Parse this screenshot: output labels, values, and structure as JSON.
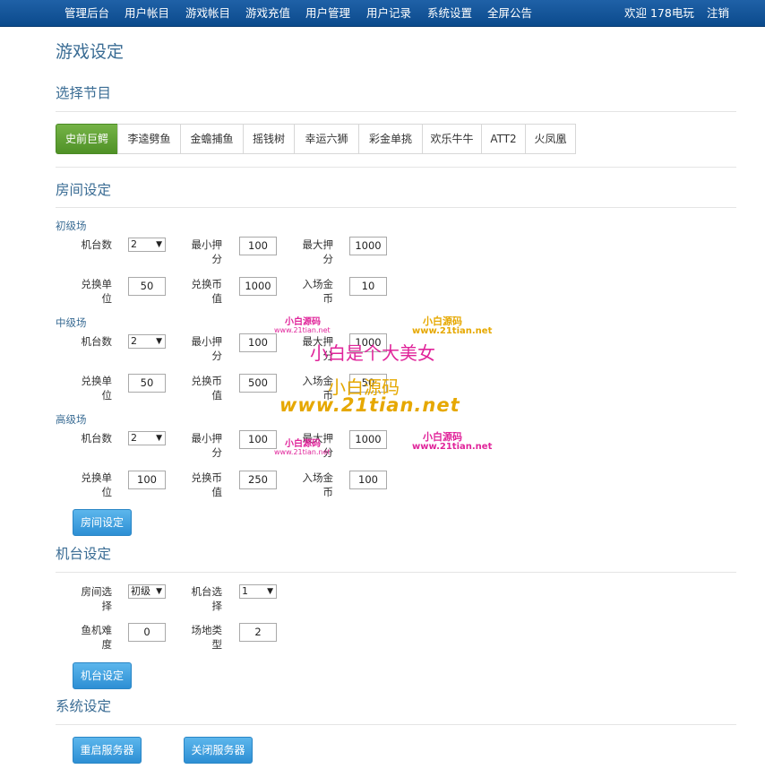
{
  "nav": {
    "items": [
      "管理后台",
      "用户帐目",
      "游戏帐目",
      "游戏充值",
      "用户管理",
      "用户记录",
      "系统设置",
      "全屏公告"
    ],
    "welcome": "欢迎 178电玩",
    "logout": "注销"
  },
  "page_title": "游戏设定",
  "select_program": {
    "title": "选择节目",
    "tabs": [
      "史前巨鳄",
      "李逵劈鱼",
      "金蟾捕鱼",
      "摇钱树",
      "幸运六狮",
      "彩金单挑",
      "欢乐牛牛",
      "ATT2",
      "火凤凰"
    ],
    "active_index": 0
  },
  "room": {
    "title": "房间设定",
    "levels": [
      {
        "name": "初级场",
        "machines": "2",
        "min_bet": "100",
        "max_bet": "1000",
        "exchange_unit": "50",
        "exchange_coin": "1000",
        "entry_coin": "10"
      },
      {
        "name": "中级场",
        "machines": "2",
        "min_bet": "100",
        "max_bet": "1000",
        "exchange_unit": "50",
        "exchange_coin": "500",
        "entry_coin": "50"
      },
      {
        "name": "高级场",
        "machines": "2",
        "min_bet": "100",
        "max_bet": "1000",
        "exchange_unit": "100",
        "exchange_coin": "250",
        "entry_coin": "100"
      }
    ],
    "labels": {
      "machines": "机台数",
      "min_bet": "最小押分",
      "max_bet": "最大押分",
      "exchange_unit": "兑换单位",
      "exchange_coin": "兑换币值",
      "entry_coin": "入场金币"
    },
    "button": "房间设定"
  },
  "machine": {
    "title": "机台设定",
    "room_select_label": "房间选择",
    "room_select_value": "初级",
    "machine_select_label": "机台选择",
    "machine_select_value": "1",
    "fish_difficulty_label": "鱼机难度",
    "fish_difficulty_value": "0",
    "venue_type_label": "场地类型",
    "venue_type_value": "2",
    "button": "机台设定"
  },
  "system": {
    "title": "系统设定",
    "restart_button": "重启服务器",
    "close_button": "关闭服务器"
  },
  "watermarks": {
    "small_cn": "小白源码",
    "small_url": "www.21tian.net",
    "big_cn1": "小白是个大美女",
    "big_cn2": "小白源码",
    "big_url": "www.21tian.net"
  },
  "colors": {
    "navbar": "#0f548f",
    "active_tab": "#5fa134",
    "button": "#3a9ad9",
    "heading": "#3a6c94",
    "watermark_pink": "#e0249a",
    "watermark_gold": "#e6a800"
  }
}
